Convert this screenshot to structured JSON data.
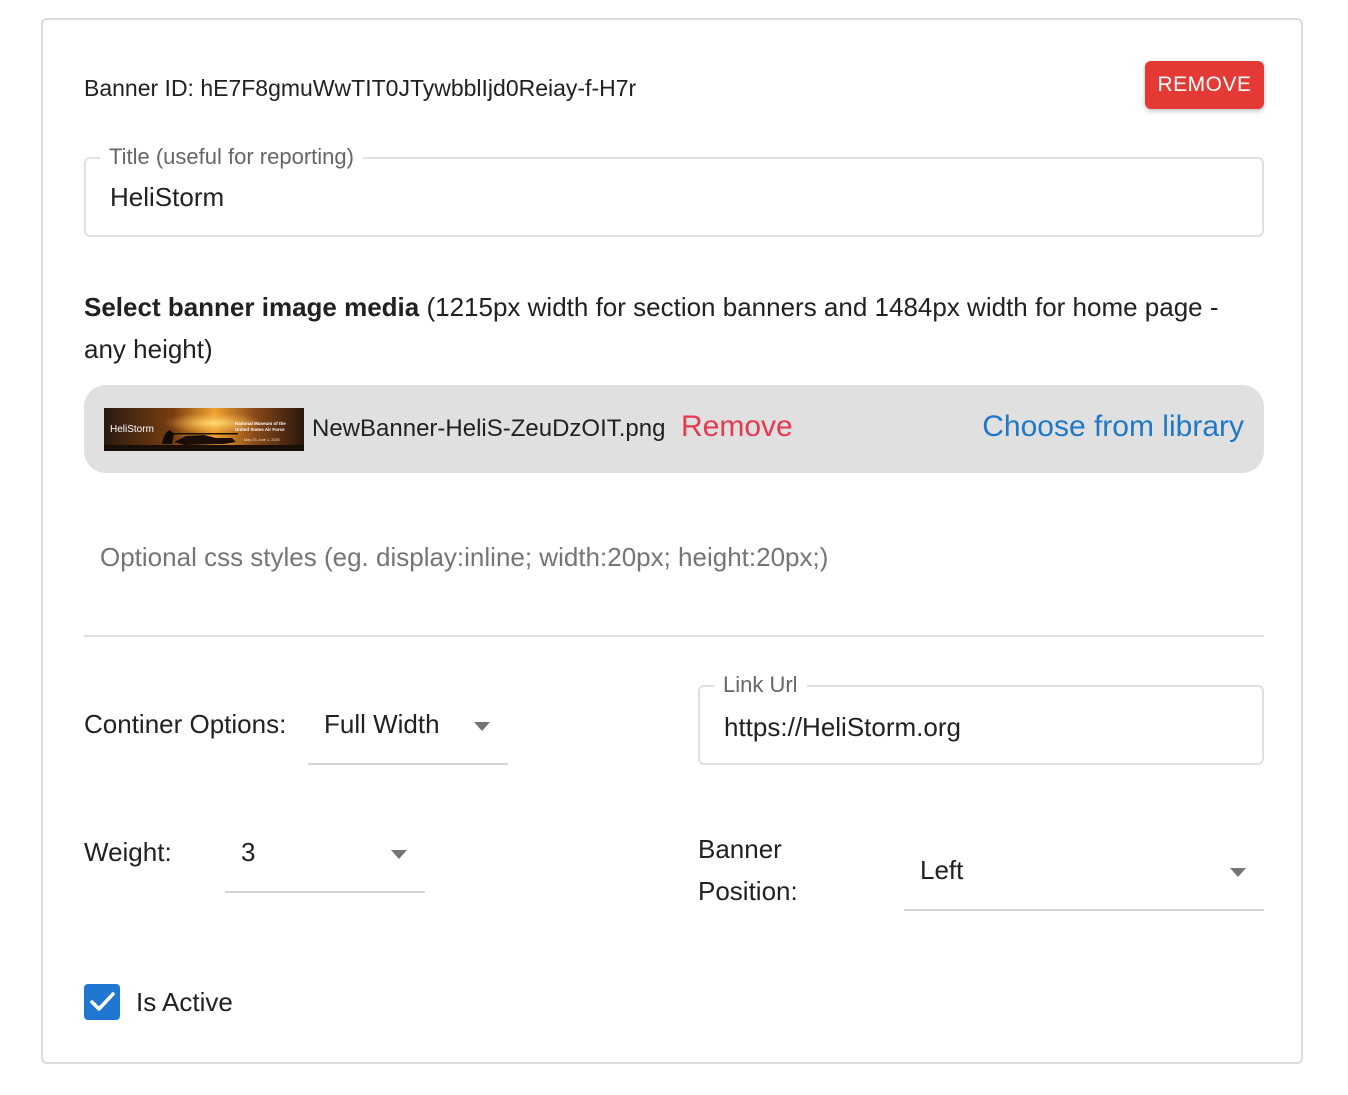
{
  "header": {
    "banner_id": "Banner ID: hE7F8gmuWwTIT0JTywbblIjd0Reiay-f-H7r",
    "remove_label": "REMOVE"
  },
  "title_field": {
    "label": "Title (useful for reporting)",
    "value": "HeliStorm"
  },
  "media": {
    "heading_bold": "Select banner image media",
    "heading_rest": " (1215px width for section banners and 1484px width for home page - any height)",
    "file_name": "NewBanner-HeliS-ZeuDzOIT.png",
    "remove_label": "Remove",
    "choose_label": "Choose from library",
    "thumbnail": {
      "brand": "HeliStorm",
      "line1": "National Museum of the",
      "line2": "United States Air Force",
      "dates": "May 29-June 1, 2025"
    }
  },
  "css_styles": {
    "placeholder": "Optional css styles (eg. display:inline; width:20px; height:20px;)"
  },
  "container_options": {
    "label": "Continer Options:",
    "selected": "Full Width"
  },
  "link_url": {
    "label": "Link Url",
    "value": "https://HeliStorm.org"
  },
  "weight": {
    "label": "Weight:",
    "selected": "3"
  },
  "banner_position": {
    "label_line1": "Banner",
    "label_line2": "Position:",
    "selected": "Left"
  },
  "is_active": {
    "label": "Is Active",
    "checked": true
  },
  "colors": {
    "danger": "#e53935",
    "link": "#1e78c8",
    "checkbox": "#1e78d2"
  }
}
